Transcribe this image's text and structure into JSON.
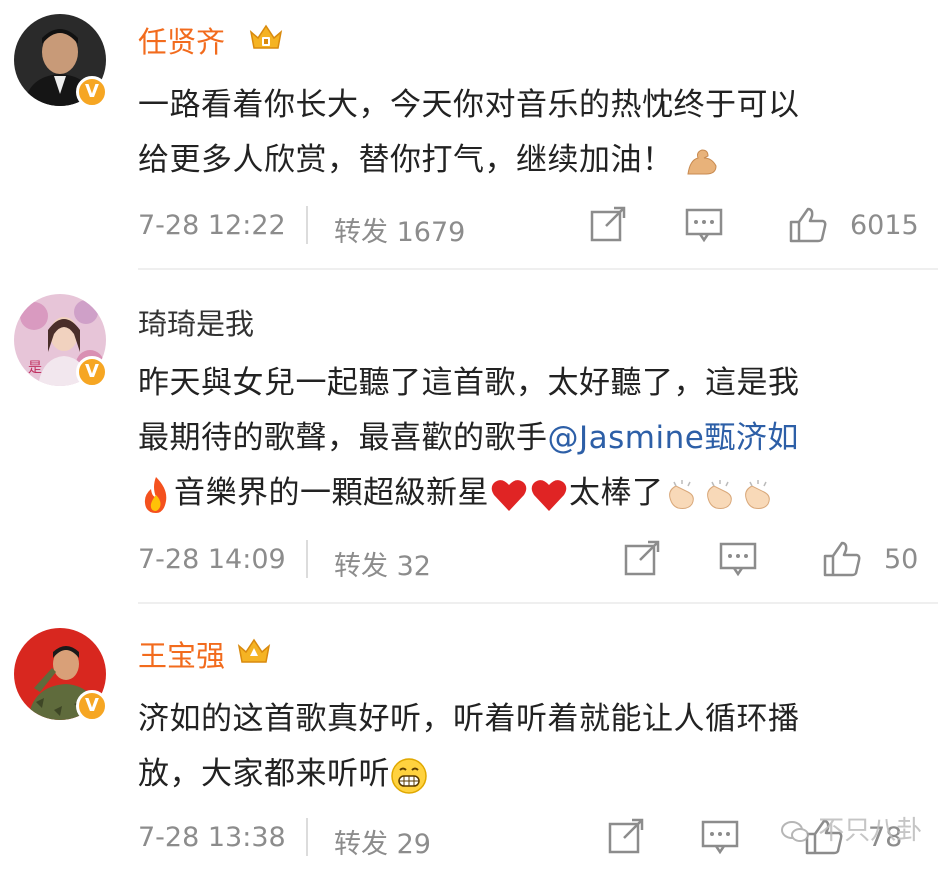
{
  "comments": [
    {
      "name": "任贤齐",
      "text_line1": "一路看着你长大，今天你对音乐的热忱终于可以",
      "text_line2": "给更多人欣赏，替你打气，继续加油！",
      "time": "7-28 12:22",
      "repost": "转发 1679",
      "likes": "6015",
      "emoji": "flexed-biceps"
    },
    {
      "name": "琦琦是我",
      "text_line1": "昨天與女兒一起聽了這首歌，太好聽了，這是我",
      "text_line2_pre": "最期待的歌聲，最喜歡的歌手",
      "mention": "@Jasmine甄济如",
      "text_line3": "音樂界的一顆超級新星",
      "text_line3_post": "太棒了",
      "time": "7-28 14:09",
      "repost": "转发 32",
      "likes": "50"
    },
    {
      "name": "王宝强",
      "text_line1": "济如的这首歌真好听，听着听着就能让人循环播",
      "text_line2": "放，大家都来听听",
      "time": "7-28 13:38",
      "repost": "转发 29",
      "likes": "78",
      "emoji": "grinning-face"
    }
  ],
  "watermark": "不只八卦",
  "colors": {
    "vip_name": "#f26b1d",
    "mention": "#2d5fa7",
    "meta": "#8c8c8c",
    "badge": "#f6a623"
  }
}
